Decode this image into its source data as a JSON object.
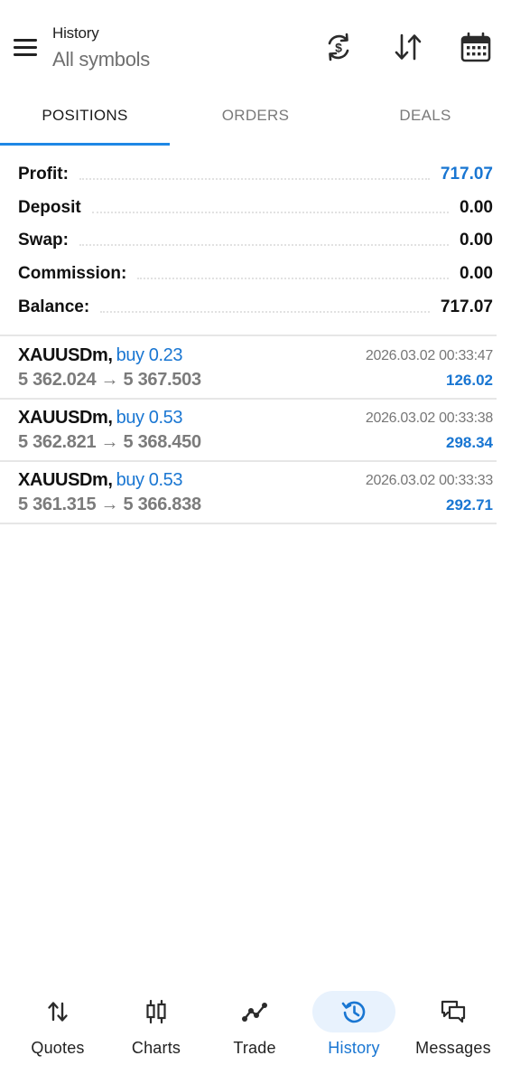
{
  "header": {
    "title": "History",
    "subtitle": "All symbols"
  },
  "tabs": [
    {
      "label": "POSITIONS",
      "active": true
    },
    {
      "label": "ORDERS",
      "active": false
    },
    {
      "label": "DEALS",
      "active": false
    }
  ],
  "summary": {
    "profit": {
      "label": "Profit:",
      "value": "717.07"
    },
    "deposit": {
      "label": "Deposit",
      "value": "0.00"
    },
    "swap": {
      "label": "Swap:",
      "value": "0.00"
    },
    "commission": {
      "label": "Commission:",
      "value": "0.00"
    },
    "balance": {
      "label": "Balance:",
      "value": "717.07"
    }
  },
  "positions": [
    {
      "symbol": "XAUUSDm,",
      "side": "buy 0.23",
      "prices": "5 362.024 → 5 367.503",
      "time": "2026.03.02 00:33:47",
      "profit": "126.02"
    },
    {
      "symbol": "XAUUSDm,",
      "side": "buy 0.53",
      "prices": "5 362.821 → 5 368.450",
      "time": "2026.03.02 00:33:38",
      "profit": "298.34"
    },
    {
      "symbol": "XAUUSDm,",
      "side": "buy 0.53",
      "prices": "5 361.315 → 5 366.838",
      "time": "2026.03.02 00:33:33",
      "profit": "292.71"
    }
  ],
  "bottom_nav": [
    {
      "label": "Quotes",
      "icon": "quotes-icon",
      "active": false
    },
    {
      "label": "Charts",
      "icon": "charts-icon",
      "active": false
    },
    {
      "label": "Trade",
      "icon": "trade-icon",
      "active": false
    },
    {
      "label": "History",
      "icon": "history-icon",
      "active": true
    },
    {
      "label": "Messages",
      "icon": "messages-icon",
      "active": false
    }
  ],
  "colors": {
    "accent": "#1976d2",
    "tab_indicator": "#1e88e5",
    "active_nav_pill": "#e8f2fd",
    "muted_text": "#7b7b7b"
  }
}
